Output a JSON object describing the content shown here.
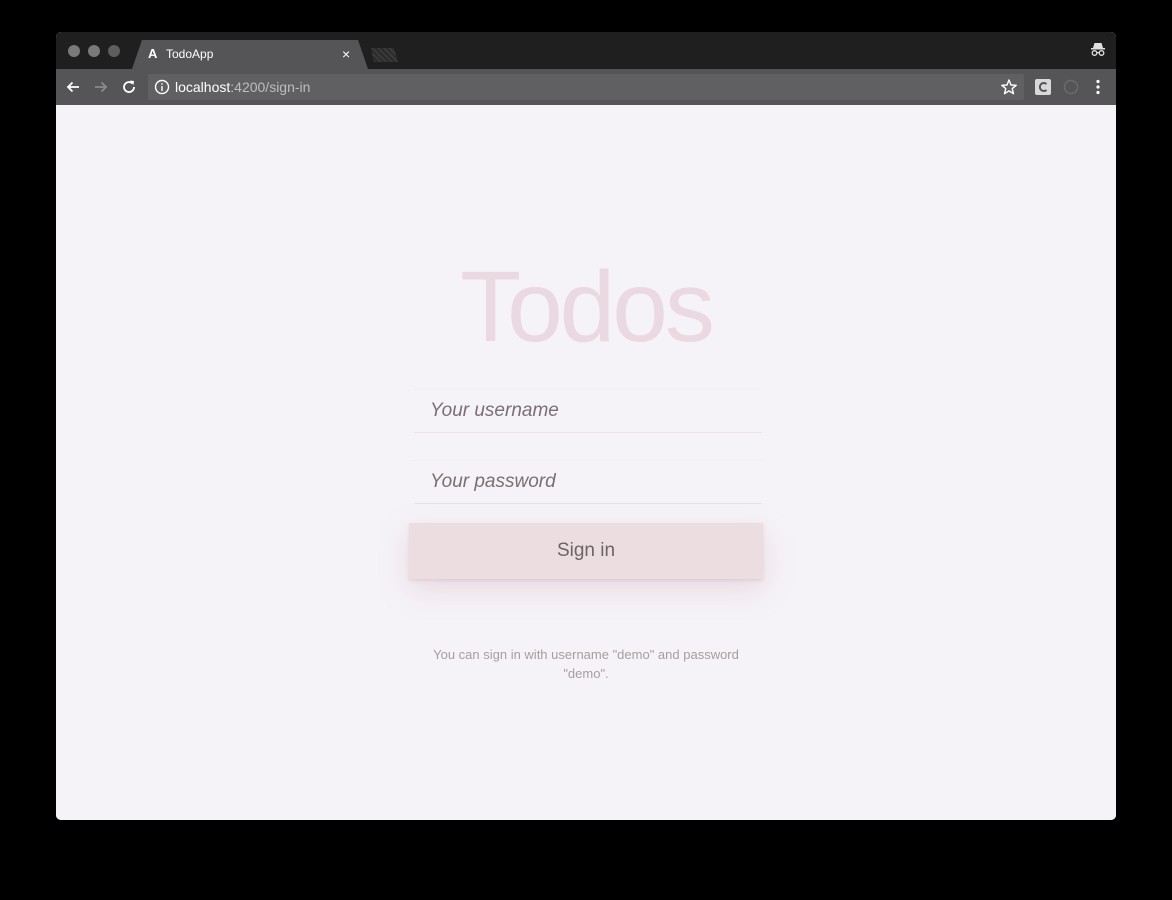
{
  "browser": {
    "tab": {
      "favicon": "A",
      "title": "TodoApp",
      "close_label": "×"
    },
    "toolbar": {
      "back_icon": "back-arrow-icon",
      "forward_icon": "forward-arrow-icon",
      "reload_icon": "reload-icon",
      "url_host": "localhost",
      "url_path": ":4200/sign-in",
      "info_icon": "info-icon",
      "star_icon": "star-icon",
      "extension_icon": "extension-icon",
      "menu_icon": "kebab-menu-icon"
    },
    "incognito_icon": "incognito-icon"
  },
  "page": {
    "logo": "Todos",
    "username": {
      "placeholder": "Your username",
      "value": ""
    },
    "password": {
      "placeholder": "Your password",
      "value": ""
    },
    "signin_label": "Sign in",
    "hint": "You can sign in with username \"demo\" and password \"demo\"."
  },
  "colors": {
    "page_background": "#f5f3f7",
    "logo": "#ead9e0",
    "button_background": "#ecdde1",
    "chrome_dark": "#1f1f1f",
    "chrome_toolbar": "#555557"
  }
}
